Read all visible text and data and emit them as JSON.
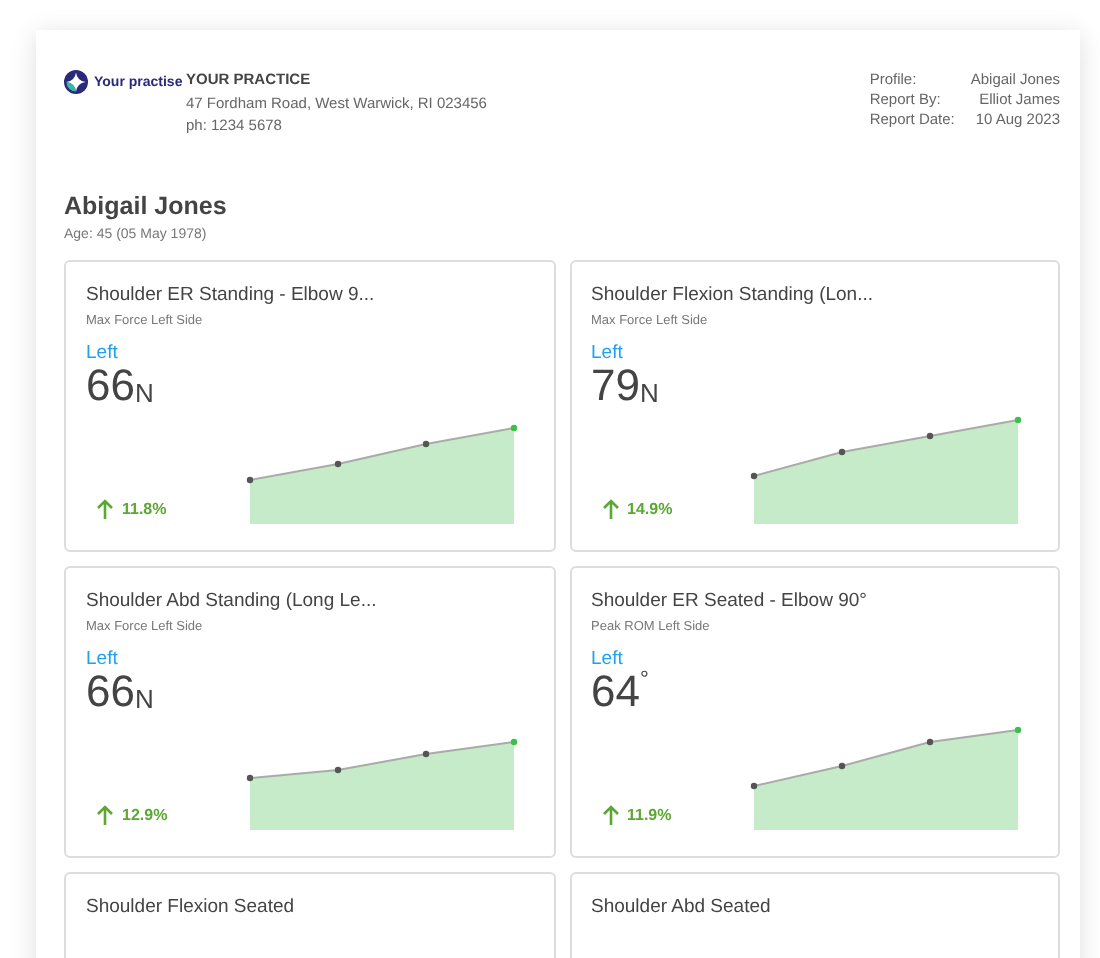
{
  "practice": {
    "logo_text": "Your practise",
    "name": "YOUR PRACTICE",
    "address": "47 Fordham Road, West Warwick, RI 023456",
    "phone": "ph: 1234 5678"
  },
  "report_info": [
    {
      "label": "Profile:",
      "value": "Abigail Jones"
    },
    {
      "label": "Report By:",
      "value": "Elliot James"
    },
    {
      "label": "Report Date:",
      "value": "10 Aug 2023"
    }
  ],
  "patient": {
    "name": "Abigail Jones",
    "age": "Age: 45 (05 May 1978)"
  },
  "cards": [
    {
      "title": "Shoulder ER Standing - Elbow 9...",
      "subtitle": "Max Force Left Side",
      "side": "Left",
      "value": "66",
      "unit": "N",
      "kind": "force",
      "change": "11.8%"
    },
    {
      "title": "Shoulder Flexion Standing (Lon...",
      "subtitle": "Max Force Left Side",
      "side": "Left",
      "value": "79",
      "unit": "N",
      "kind": "force",
      "change": "14.9%"
    },
    {
      "title": "Shoulder Abd Standing (Long Le...",
      "subtitle": "Max Force Left Side",
      "side": "Left",
      "value": "66",
      "unit": "N",
      "kind": "force",
      "change": "12.9%"
    },
    {
      "title": "Shoulder ER Seated - Elbow 90°",
      "subtitle": "Peak ROM Left Side",
      "side": "Left",
      "value": "64",
      "unit": "°",
      "kind": "angle",
      "change": "11.9%"
    },
    {
      "title": "Shoulder Flexion Seated"
    },
    {
      "title": "Shoulder Abd Seated"
    }
  ]
}
